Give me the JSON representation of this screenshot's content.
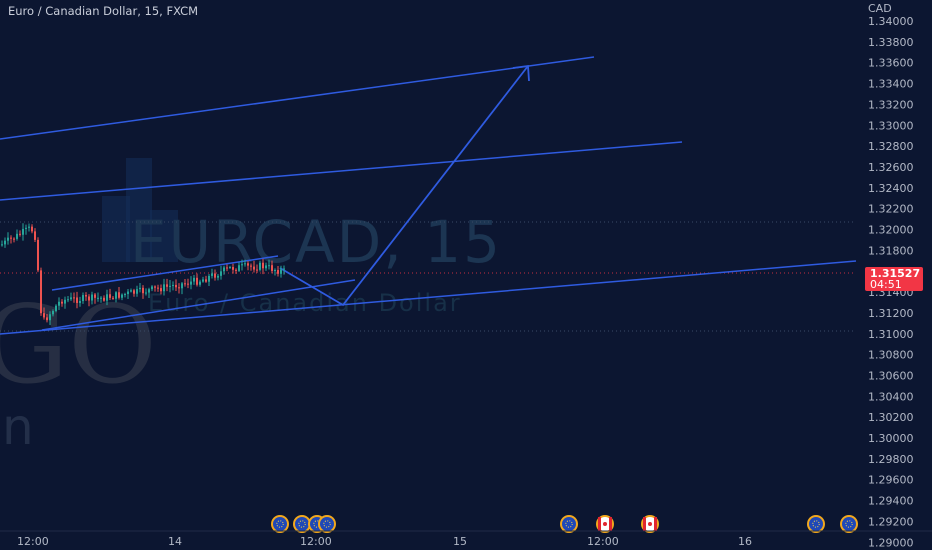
{
  "header": {
    "symbol_text": "Euro / Canadian Dollar, 15, FXCM"
  },
  "watermark": {
    "ticker": "EURCAD, 15",
    "name": "Euro / Canadian Dollar",
    "logo_letters": "GO",
    "logo_sub": "n"
  },
  "price_axis": {
    "currency": "CAD",
    "ticks": [
      "1.34000",
      "1.33800",
      "1.33600",
      "1.33400",
      "1.33200",
      "1.33000",
      "1.32800",
      "1.32600",
      "1.32400",
      "1.32200",
      "1.32000",
      "1.31800",
      "1.31600",
      "1.31400",
      "1.31200",
      "1.31000",
      "1.30800",
      "1.30600",
      "1.30400",
      "1.30200",
      "1.30000",
      "1.29800",
      "1.29600",
      "1.29400",
      "1.29200",
      "1.29000"
    ]
  },
  "current_price": {
    "value": "1.31527",
    "countdown": "04:51",
    "color": "#f23645"
  },
  "time_axis": {
    "labels": [
      "12:00",
      "14",
      "12:00",
      "15",
      "12:00",
      "16"
    ]
  },
  "colors": {
    "background": "#0c1631",
    "drawing": "#2f5be0",
    "candle_up": "#26a69a",
    "candle_down": "#ef5350"
  },
  "event_icons": [
    "eu-flag-icon",
    "eu-flag-icon",
    "eu-flag-icon",
    "eu-flag-icon",
    "canada-flag-icon",
    "canada-flag-icon",
    "eu-flag-icon",
    "eu-flag-icon"
  ],
  "chart_data": {
    "type": "candlestick",
    "title": "Euro / Canadian Dollar, 15, FXCM",
    "ylabel": "CAD",
    "ylim": [
      1.29,
      1.34
    ],
    "current_price": 1.31527,
    "x_labels": [
      "12:00",
      "14",
      "12:00",
      "15",
      "12:00",
      "16"
    ],
    "grid": false,
    "drawings": {
      "channel_lines": 5,
      "projection_path": [
        "pullback to 1.3122",
        "rally to 1.3360"
      ]
    }
  }
}
